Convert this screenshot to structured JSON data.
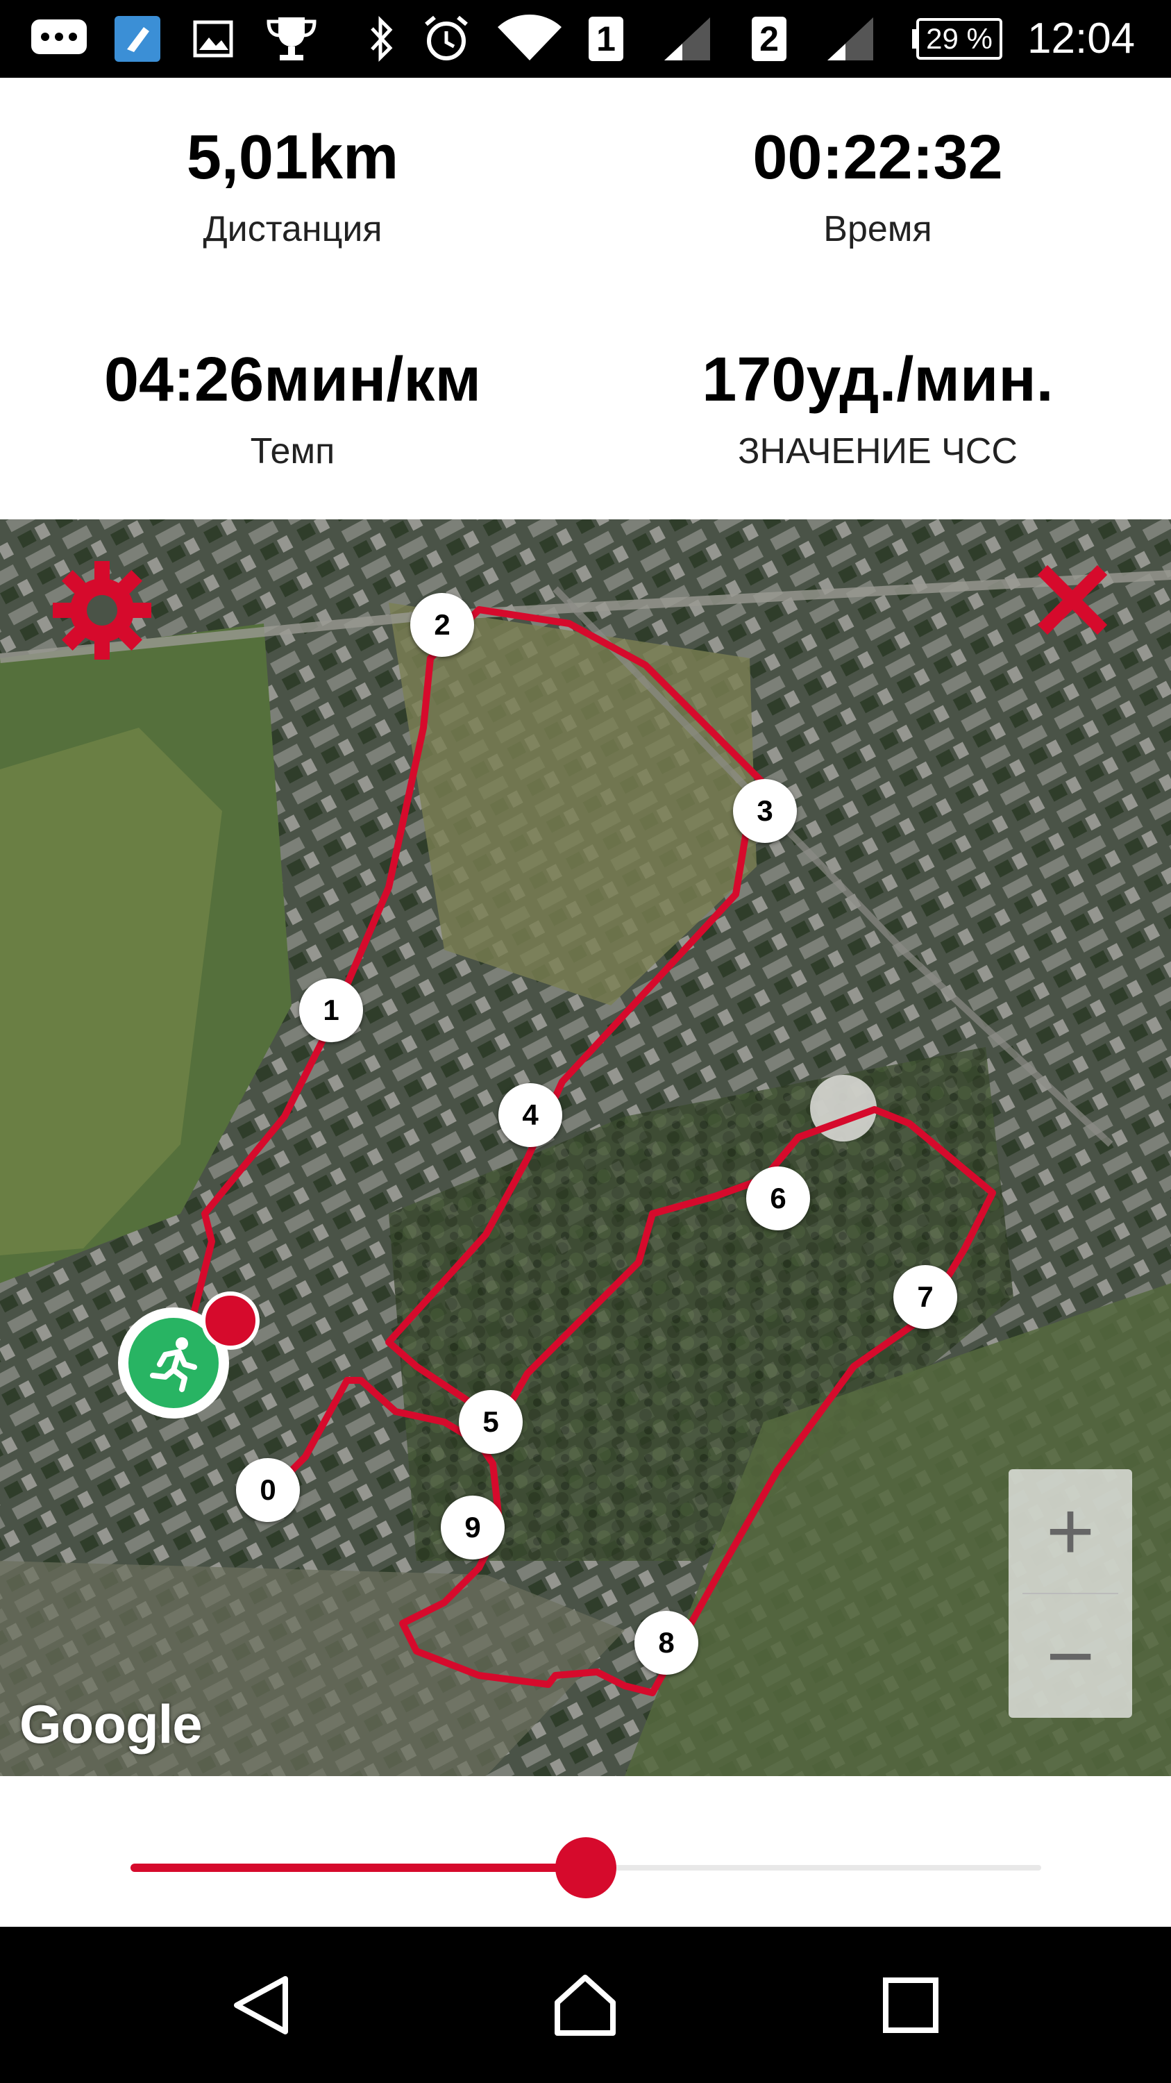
{
  "status_bar": {
    "icons": [
      "messages-icon",
      "flashlight-app-icon",
      "gallery-icon",
      "trophy-icon",
      "bluetooth-icon",
      "alarm-icon",
      "wifi-icon",
      "sim1-signal-icon",
      "sim2-signal-icon"
    ],
    "sim1_label": "1",
    "sim2_label": "2",
    "battery": "29 %",
    "time": "12:04"
  },
  "stats": {
    "distance": {
      "value": "5,01km",
      "label": "Дистанция"
    },
    "time": {
      "value": "00:22:32",
      "label": "Время"
    },
    "pace": {
      "value": "04:26мин/км",
      "label": "Темп"
    },
    "heart_rate": {
      "value": "170уд./мин.",
      "label": "ЗНАЧЕНИЕ ЧСС"
    }
  },
  "map": {
    "route_color": "#d60a2c",
    "markers": [
      "1",
      "2",
      "3",
      "4",
      "5",
      "6",
      "7",
      "8",
      "9",
      "0"
    ],
    "google_label": "Google",
    "settings_icon": "gear-icon",
    "close_icon": "close-icon",
    "zoom_in_label": "+",
    "zoom_out_label": "−",
    "start_icon": "running-man-icon"
  },
  "slider": {
    "progress": 0.5,
    "accent": "#d60a2c"
  },
  "nav_bar": {
    "icons": [
      "back-icon",
      "home-icon",
      "recents-icon"
    ]
  }
}
